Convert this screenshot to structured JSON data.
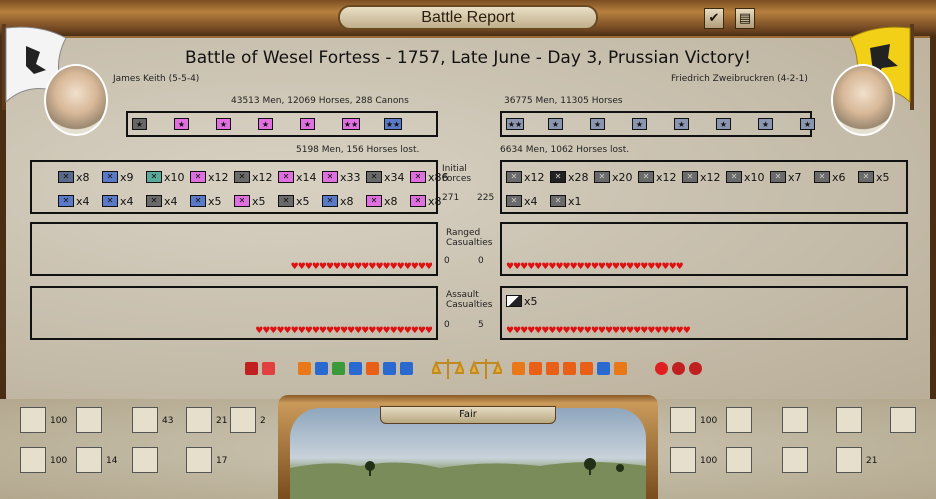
{
  "window": {
    "title": "Battle Report"
  },
  "battle": {
    "heading": "Battle of Wesel Fortess - 1757, Late June - Day 3, Prussian Victory!"
  },
  "left": {
    "general": "James Keith (5-5-4)",
    "forces": "43513 Men, 12069 Horses, 288 Canons",
    "lost": "5198 Men, 156 Horses lost.",
    "stars": [
      "★",
      "★",
      "★",
      "★",
      "★",
      "★★",
      "★★"
    ],
    "units_row1": [
      {
        "c": "#5a6a8a",
        "q": "x8"
      },
      {
        "c": "#5a7ac8",
        "q": "x9"
      },
      {
        "c": "#5aaa9a",
        "q": "x10"
      },
      {
        "c": "#e070e0",
        "q": "x12"
      },
      {
        "c": "#6a6a6a",
        "q": "x12"
      },
      {
        "c": "#e070e0",
        "q": "x14"
      },
      {
        "c": "#e070e0",
        "q": "x33"
      },
      {
        "c": "#6a6a6a",
        "q": "x34"
      },
      {
        "c": "#e070e0",
        "q": "x86"
      }
    ],
    "units_row2": [
      {
        "c": "#5a7ac8",
        "q": "x4"
      },
      {
        "c": "#5a7ac8",
        "q": "x4"
      },
      {
        "c": "#6a6a6a",
        "q": "x4"
      },
      {
        "c": "#5a7ac8",
        "q": "x5"
      },
      {
        "c": "#e070e0",
        "q": "x5"
      },
      {
        "c": "#6a6a6a",
        "q": "x5"
      },
      {
        "c": "#5a7ac8",
        "q": "x8"
      },
      {
        "c": "#e070e0",
        "q": "x8"
      },
      {
        "c": "#e070e0",
        "q": "x8"
      }
    ],
    "ranged_hearts": "♥♥♥♥♥♥♥♥♥♥♥♥♥♥♥♥♥♥♥♥",
    "assault_hearts": "♥♥♥♥♥♥♥♥♥♥♥♥♥♥♥♥♥♥♥♥♥♥♥♥♥"
  },
  "right": {
    "general": "Friedrich Zweibruckren (4-2-1)",
    "forces": "36775 Men, 11305 Horses",
    "lost": "6634 Men, 1062 Horses lost.",
    "stars": [
      "★★",
      "★",
      "★",
      "★",
      "★",
      "★",
      "★",
      "★"
    ],
    "units_row1": [
      {
        "c": "#6a6a6a",
        "q": "x12"
      },
      {
        "c": "#222222",
        "q": "x28"
      },
      {
        "c": "#6a6a6a",
        "q": "x20"
      },
      {
        "c": "#6a6a6a",
        "q": "x12"
      },
      {
        "c": "#6a6a6a",
        "q": "x12"
      },
      {
        "c": "#6a6a6a",
        "q": "x10"
      },
      {
        "c": "#6a6a6a",
        "q": "x7"
      },
      {
        "c": "#6a6a6a",
        "q": "x6"
      },
      {
        "c": "#6a6a6a",
        "q": "x5"
      }
    ],
    "units_row2": [
      {
        "c": "#6a6a6a",
        "q": "x4"
      },
      {
        "c": "#6a6a6a",
        "q": "x1"
      }
    ],
    "assault_unit": "x5",
    "ranged_hearts": "♥♥♥♥♥♥♥♥♥♥♥♥♥♥♥♥♥♥♥♥♥♥♥♥♥",
    "assault_hearts": "♥♥♥♥♥♥♥♥♥♥♥♥♥♥♥♥♥♥♥♥♥♥♥♥♥♥"
  },
  "middle": {
    "initial_label": "Initial Forces",
    "initial_left": "271",
    "initial_right": "225",
    "ranged_label": "Ranged Casualties",
    "ranged_left": "0",
    "ranged_right": "0",
    "assault_label": "Assault Casualties",
    "assault_left": "0",
    "assault_right": "5"
  },
  "bottom": {
    "weather": "Fair",
    "left_tiles": [
      {
        "n": "100"
      },
      {
        "n": ""
      },
      {
        "n": "43"
      },
      {
        "n": "21"
      },
      {
        "n": "2"
      },
      {
        "n": "100"
      },
      {
        "n": "14"
      },
      {
        "n": ""
      },
      {
        "n": "17"
      }
    ],
    "right_tiles": [
      {
        "n": "100"
      },
      {
        "n": ""
      },
      {
        "n": ""
      },
      {
        "n": ""
      },
      {
        "n": ""
      },
      {
        "n": "100"
      },
      {
        "n": ""
      },
      {
        "n": ""
      },
      {
        "n": "21"
      }
    ]
  },
  "colors": {
    "heart": "#e01010",
    "parchment": "#cfc7b6",
    "frame": "#7a4d22"
  }
}
